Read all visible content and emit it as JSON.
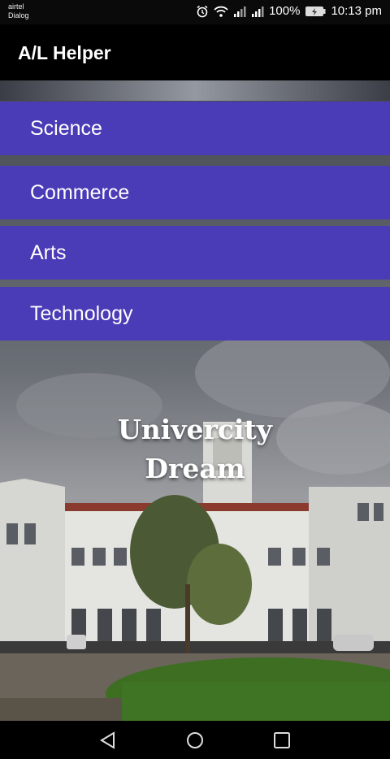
{
  "status": {
    "carrier1": "airtel",
    "carrier2": "Dialog",
    "battery": "100%",
    "time": "10:13 pm"
  },
  "app": {
    "title": "A/L Helper"
  },
  "categories": [
    {
      "label": "Science"
    },
    {
      "label": "Commerce"
    },
    {
      "label": "Arts"
    },
    {
      "label": "Technology"
    }
  ],
  "headline": {
    "line1": "Univercity",
    "line2": "Dream"
  },
  "icons": {
    "alarm": "alarm-icon",
    "wifi": "wifi-icon",
    "signal": "signal-icon",
    "battery": "battery-icon",
    "back": "back-icon",
    "home": "home-icon",
    "recents": "recents-icon"
  },
  "colors": {
    "category_bg": "#4a3bb6",
    "bar_bg": "#000000"
  }
}
